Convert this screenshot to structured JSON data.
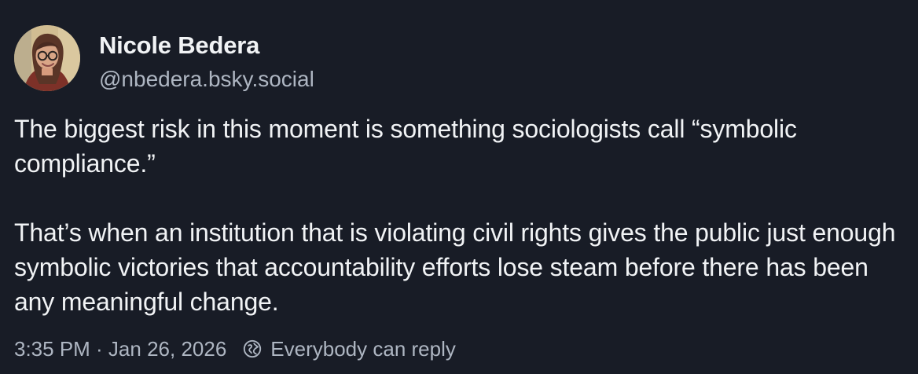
{
  "post": {
    "author": {
      "display_name": "Nicole Bedera",
      "handle": "@nbedera.bsky.social"
    },
    "text": {
      "paragraph_1": "The biggest risk in this moment is something sociologists call “symbolic compliance.”",
      "paragraph_2": "That’s when an institution that is violating civil rights gives the public just enough symbolic victories that accountability efforts lose steam before there has been any meaningful change."
    },
    "timestamp": "3:35 PM · Jan 26, 2026",
    "reply_setting": "Everybody can reply"
  },
  "colors": {
    "background": "#181c26",
    "primary_text": "#f1f3f5",
    "secondary_text": "#aeb6c2"
  },
  "icons": {
    "reply_setting": "globe-icon"
  }
}
